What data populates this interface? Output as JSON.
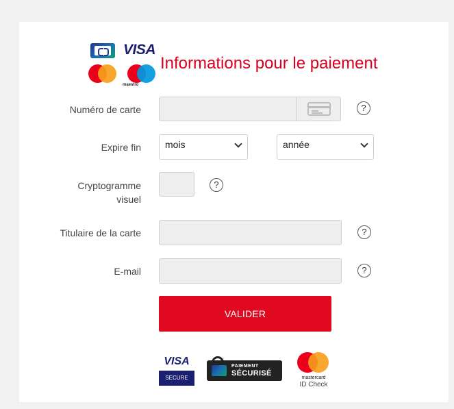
{
  "header": {
    "title": "Informations pour le paiement",
    "logos": {
      "visa": "VISA",
      "maestro": "maestro"
    }
  },
  "form": {
    "card_number": {
      "label": "Numéro de carte",
      "value": "",
      "placeholder": ""
    },
    "expiry": {
      "label": "Expire fin",
      "month": "mois",
      "year": "année"
    },
    "cvv": {
      "label_line1": "Cryptogramme",
      "label_line2": "visuel",
      "value": ""
    },
    "holder": {
      "label": "Titulaire de la carte",
      "value": ""
    },
    "email": {
      "label": "E-mail",
      "value": ""
    },
    "help_glyph": "?",
    "submit_label": "VALIDER"
  },
  "footer": {
    "visa_secure": {
      "brand": "VISA",
      "sub": "SECURE"
    },
    "paiement_securise": {
      "line1": "PAIEMENT",
      "line2": "SÉCURISÉ"
    },
    "mastercard": {
      "name": "mastercard",
      "sub": "ID Check"
    }
  },
  "colors": {
    "accent": "#e0091f",
    "title": "#d8001e",
    "background": "#f1f1f1"
  }
}
